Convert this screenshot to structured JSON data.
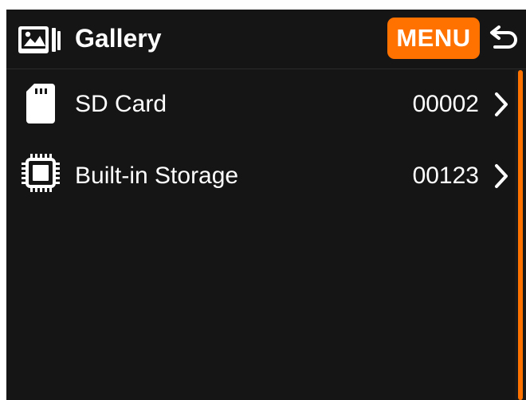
{
  "header": {
    "title": "Gallery",
    "title_icon": "gallery-icon",
    "menu_label": "MENU",
    "back_icon": "back-arrow-icon"
  },
  "storage": [
    {
      "icon": "sd-card-icon",
      "label": "SD Card",
      "count": "00002",
      "chevron_icon": "chevron-right-icon"
    },
    {
      "icon": "chip-icon",
      "label": "Built-in Storage",
      "count": "00123",
      "chevron_icon": "chevron-right-icon"
    }
  ],
  "scrollbar": {
    "visible_fraction": 1
  },
  "colors": {
    "background": "#151515",
    "accent": "#ff7200",
    "text": "#ffffff"
  }
}
